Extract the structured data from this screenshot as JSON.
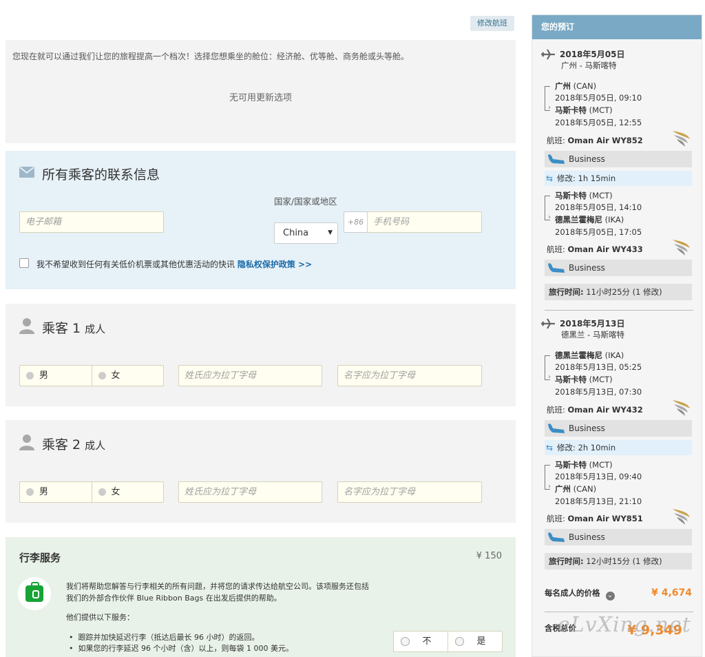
{
  "header": {
    "modify_flight": "修改航班"
  },
  "upgrade": {
    "intro": "您现在就可以通过我们让您的旅程提高一个档次！选择您想乘坐的舱位：经济舱、优等舱、商务舱或头等舱。",
    "none": "无可用更新选项"
  },
  "contact": {
    "title": "所有乘客的联系信息",
    "email_placeholder": "电子邮箱",
    "country_label": "国家/国家或地区",
    "country_value": "China",
    "phone_prefix": "+86",
    "phone_placeholder": "手机号码",
    "opt_out_label": "我不希望收到任何有关低价机票或其他优惠活动的快讯",
    "privacy_link": "隐私权保护政策 >>"
  },
  "passengers": [
    {
      "title": "乘客 1",
      "type": "成人",
      "male": "男",
      "female": "女",
      "surname_placeholder": "姓氏应为拉丁字母",
      "given_placeholder": "名字应为拉丁字母"
    },
    {
      "title": "乘客 2",
      "type": "成人",
      "male": "男",
      "female": "女",
      "surname_placeholder": "姓氏应为拉丁字母",
      "given_placeholder": "名字应为拉丁字母"
    }
  ],
  "baggage": {
    "title": "行李服务",
    "price": "¥ 150",
    "description": "我们将帮助您解答与行李相关的所有问题，并将您的请求传达给航空公司。该项服务还包括我们的外部合作伙伴 Blue Ribbon Bags 在出发后提供的帮助。",
    "services_title": "他们提供以下服务：",
    "items": [
      "跟踪并加快延迟行李（抵达后最长 96 小时）的返回。",
      "如果您的行李延迟 96 个小时（含）以上，则每袋 1 000 美元。"
    ],
    "no": "不",
    "yes": "是"
  },
  "sidebar": {
    "title": "您的预订",
    "flight_label": "航班:",
    "legs": [
      {
        "date": "2018年5月05日",
        "route": "广州 - 马斯喀特",
        "segments": [
          {
            "from_city": "广州",
            "from_code": "(CAN)",
            "dep": "2018年5月05日, 09:10",
            "to_city": "马斯卡特",
            "to_code": "(MCT)",
            "arr": "2018年5月05日, 12:55",
            "flight": "Oman Air WY852",
            "cabin": "Business"
          },
          {
            "from_city": "马斯卡特",
            "from_code": "(MCT)",
            "dep": "2018年5月05日, 14:10",
            "to_city": "德黑兰霍梅尼",
            "to_code": "(IKA)",
            "arr": "2018年5月05日, 17:05",
            "flight": "Oman Air WY433",
            "cabin": "Business"
          }
        ],
        "stopover": "修改: 1h 15min",
        "travel_label": "旅行时间:",
        "travel_time": "11小时25分 (1 修改)"
      },
      {
        "date": "2018年5月13日",
        "route": "德黑兰 - 马斯喀特",
        "segments": [
          {
            "from_city": "德黑兰霍梅尼",
            "from_code": "(IKA)",
            "dep": "2018年5月13日, 05:25",
            "to_city": "马斯卡特",
            "to_code": "(MCT)",
            "arr": "2018年5月13日, 07:30",
            "flight": "Oman Air WY432",
            "cabin": "Business"
          },
          {
            "from_city": "马斯卡特",
            "from_code": "(MCT)",
            "dep": "2018年5月13日, 09:40",
            "to_city": "广州",
            "to_code": "(CAN)",
            "arr": "2018年5月13日, 21:10",
            "flight": "Oman Air WY851",
            "cabin": "Business"
          }
        ],
        "stopover": "修改: 2h 10min",
        "travel_label": "旅行时间:",
        "travel_time": "12小时15分 (1 修改)"
      }
    ],
    "per_adult_label": "每名成人的价格",
    "per_adult_value": "¥ 4,674",
    "total_label": "含税总价",
    "total_value": "¥ 9,349"
  },
  "watermark": "eLvXing.net",
  "colors": {
    "accent": "#7aa9c5",
    "price": "#f08a2c",
    "link": "#1a6aa8",
    "green": "#18a336"
  }
}
